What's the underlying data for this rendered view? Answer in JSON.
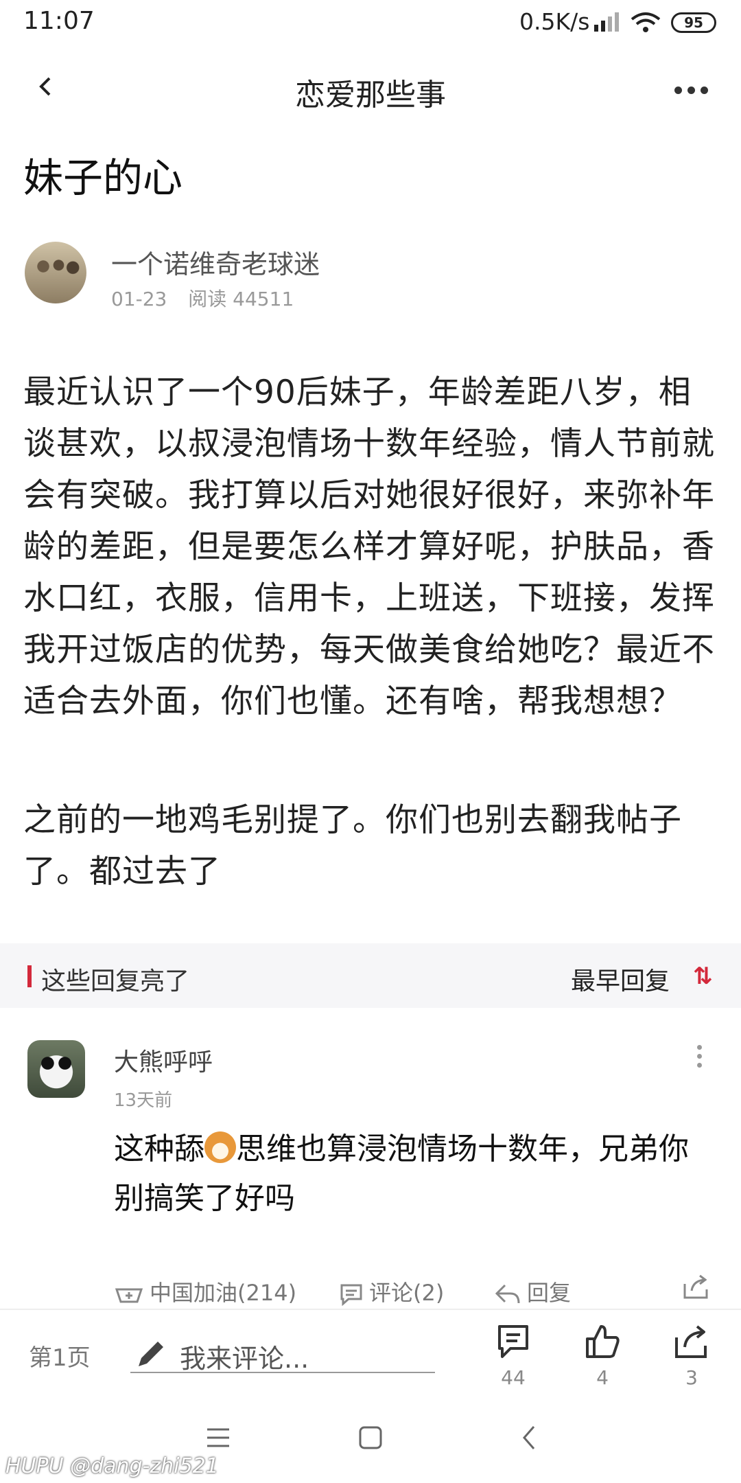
{
  "status_bar": {
    "time": "11:07",
    "speed": "0.5K/s",
    "battery": "95"
  },
  "nav": {
    "title": "恋爱那些事"
  },
  "post": {
    "title": "妹子的心",
    "author": "一个诺维奇老球迷",
    "date": "01-23",
    "reads": "阅读 44511",
    "paragraphs": [
      "最近认识了一个90后妹子，年龄差距八岁，相谈甚欢，以叔浸泡情场十数年经验，情人节前就会有突破。我打算以后对她很好很好，来弥补年龄的差距，但是要怎么样才算好呢，护肤品，香水口红，衣服，信用卡，上班送，下班接，发挥我开过饭店的优势，每天做美食给她吃？最近不适合去外面，你们也懂。还有啥，帮我想想？",
      "之前的一地鸡毛别提了。你们也别去翻我帖子了。都过去了"
    ]
  },
  "replies": {
    "header": "这些回复亮了",
    "sort": "最早回复"
  },
  "comment": {
    "name": "大熊呼呼",
    "time": "13天前",
    "text_before": "这种舔",
    "text_after": "思维也算浸泡情场十数年，兄弟你别搞笑了好吗",
    "actions": {
      "cheer": "中国加油(214)",
      "comments": "评论(2)",
      "reply": "回复"
    }
  },
  "bottom_bar": {
    "page": "第1页",
    "input_placeholder": "我来评论...",
    "comment_count": "44",
    "like_count": "4",
    "share_count": "3"
  },
  "watermark": "HUPU @dang-zhi521"
}
